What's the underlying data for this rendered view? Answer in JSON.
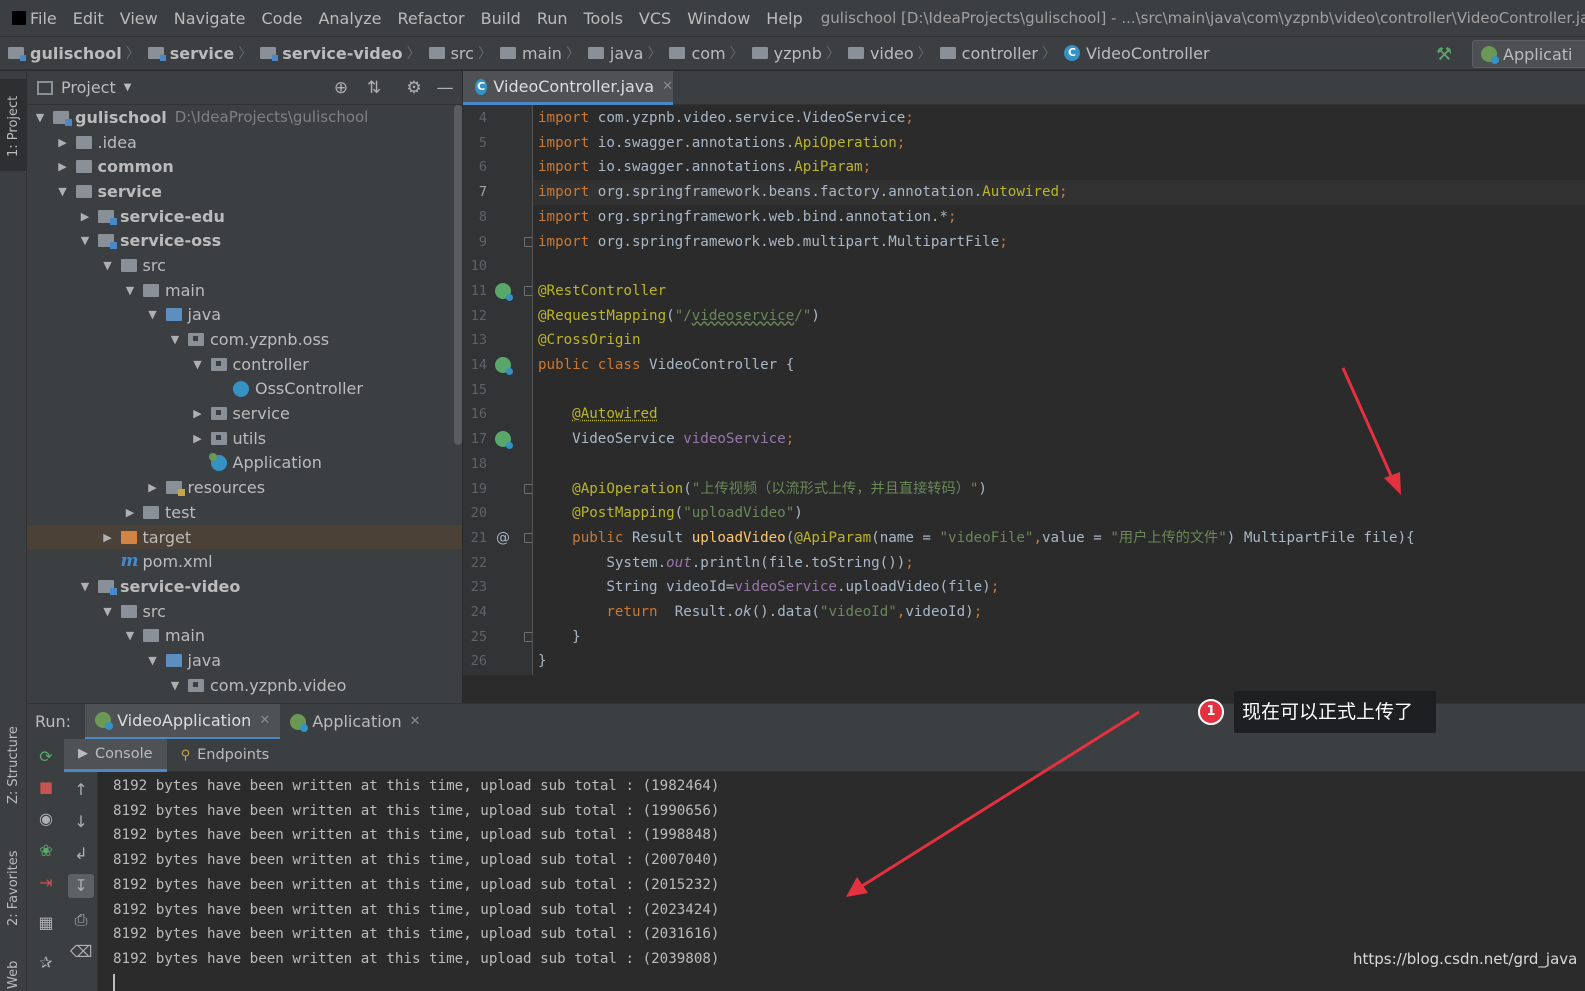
{
  "menu": {
    "items": [
      "File",
      "Edit",
      "View",
      "Navigate",
      "Code",
      "Analyze",
      "Refactor",
      "Build",
      "Run",
      "Tools",
      "VCS",
      "Window",
      "Help"
    ],
    "window_title": "gulischool [D:\\IdeaProjects\\gulischool] - ...\\src\\main\\java\\com\\yzpnb\\video\\controller\\VideoController.java [se"
  },
  "breadcrumbs": [
    "gulischool",
    "service",
    "service-video",
    "src",
    "main",
    "java",
    "com",
    "yzpnb",
    "video",
    "controller",
    "VideoController"
  ],
  "run_config": {
    "label": "Applicati"
  },
  "left_strip": {
    "project": "1: Project",
    "structure": "Z: Structure",
    "favorites": "2: Favorites",
    "web": "Web"
  },
  "project_panel": {
    "title": "Project",
    "tree": [
      {
        "label": "gulischool",
        "path": "D:\\IdeaProjects\\gulischool",
        "bold": true,
        "arrow": "open",
        "icon": "module",
        "depth": 0
      },
      {
        "label": ".idea",
        "arrow": "closed",
        "icon": "folder",
        "depth": 1
      },
      {
        "label": "common",
        "bold": true,
        "arrow": "closed",
        "icon": "folder",
        "depth": 1
      },
      {
        "label": "service",
        "bold": true,
        "arrow": "open",
        "icon": "folder",
        "depth": 1
      },
      {
        "label": "service-edu",
        "bold": true,
        "arrow": "closed",
        "icon": "module",
        "depth": 2
      },
      {
        "label": "service-oss",
        "bold": true,
        "arrow": "open",
        "icon": "module",
        "depth": 2
      },
      {
        "label": "src",
        "arrow": "open",
        "icon": "folder",
        "depth": 3
      },
      {
        "label": "main",
        "arrow": "open",
        "icon": "folder",
        "depth": 4
      },
      {
        "label": "java",
        "arrow": "open",
        "icon": "source",
        "depth": 5
      },
      {
        "label": "com.yzpnb.oss",
        "arrow": "open",
        "icon": "package",
        "depth": 6
      },
      {
        "label": "controller",
        "arrow": "open",
        "icon": "package",
        "depth": 7
      },
      {
        "label": "OssController",
        "arrow": "none",
        "icon": "cls",
        "depth": 8
      },
      {
        "label": "service",
        "arrow": "closed",
        "icon": "package",
        "depth": 7
      },
      {
        "label": "utils",
        "arrow": "closed",
        "icon": "package",
        "depth": 7
      },
      {
        "label": "Application",
        "arrow": "none",
        "icon": "appcls",
        "depth": 7
      },
      {
        "label": "resources",
        "arrow": "closed",
        "icon": "resources",
        "depth": 5
      },
      {
        "label": "test",
        "arrow": "closed",
        "icon": "folder",
        "depth": 4
      },
      {
        "label": "target",
        "arrow": "closed",
        "icon": "excluded",
        "depth": 3,
        "selected": true
      },
      {
        "label": "pom.xml",
        "arrow": "none",
        "icon": "maven",
        "depth": 3
      },
      {
        "label": "service-video",
        "bold": true,
        "arrow": "open",
        "icon": "module",
        "depth": 2
      },
      {
        "label": "src",
        "arrow": "open",
        "icon": "folder",
        "depth": 3
      },
      {
        "label": "main",
        "arrow": "open",
        "icon": "folder",
        "depth": 4
      },
      {
        "label": "java",
        "arrow": "open",
        "icon": "source",
        "depth": 5
      },
      {
        "label": "com.yzpnb.video",
        "arrow": "open",
        "icon": "package",
        "depth": 6
      }
    ]
  },
  "editor": {
    "tab_label": "VideoController.java",
    "current_line": 7,
    "lines": [
      {
        "n": 4,
        "parts": [
          [
            "kw",
            "import "
          ],
          [
            "",
            "com.yzpnb.video.service.VideoService"
          ],
          [
            "kw",
            ";"
          ]
        ]
      },
      {
        "n": 5,
        "parts": [
          [
            "kw",
            "import "
          ],
          [
            "",
            "io.swagger.annotations."
          ],
          [
            "ann",
            "ApiOperation"
          ],
          [
            "kw",
            ";"
          ]
        ]
      },
      {
        "n": 6,
        "parts": [
          [
            "kw",
            "import "
          ],
          [
            "",
            "io.swagger.annotations."
          ],
          [
            "ann",
            "ApiParam"
          ],
          [
            "kw",
            ";"
          ]
        ]
      },
      {
        "n": 7,
        "parts": [
          [
            "kw",
            "import "
          ],
          [
            "",
            "org.springframework.beans.factory.annotation."
          ],
          [
            "ann",
            "Autowired"
          ],
          [
            "kw",
            ";"
          ]
        ]
      },
      {
        "n": 8,
        "parts": [
          [
            "kw",
            "import "
          ],
          [
            "",
            "org.springframework.web.bind.annotation.*"
          ],
          [
            "kw",
            ";"
          ]
        ]
      },
      {
        "n": 9,
        "parts": [
          [
            "kw",
            "import "
          ],
          [
            "",
            "org.springframework.web.multipart.MultipartFile"
          ],
          [
            "kw",
            ";"
          ]
        ]
      },
      {
        "n": 10,
        "parts": []
      },
      {
        "n": 11,
        "parts": [
          [
            "ann",
            "@RestController"
          ]
        ]
      },
      {
        "n": 12,
        "parts": [
          [
            "ann",
            "@RequestMapping"
          ],
          [
            "",
            "("
          ],
          [
            "str",
            "\"/"
          ],
          [
            "str ulw",
            "videoservice"
          ],
          [
            "str",
            "/\""
          ],
          [
            "",
            ")"
          ]
        ]
      },
      {
        "n": 13,
        "parts": [
          [
            "ann",
            "@CrossOrigin"
          ]
        ]
      },
      {
        "n": 14,
        "parts": [
          [
            "kw",
            "public class "
          ],
          [
            "",
            "VideoController {"
          ]
        ]
      },
      {
        "n": 15,
        "parts": []
      },
      {
        "n": 16,
        "parts": [
          [
            "",
            "    "
          ],
          [
            "ann uld",
            "@Autowired"
          ]
        ]
      },
      {
        "n": 17,
        "parts": [
          [
            "",
            "    VideoService "
          ],
          [
            "fld",
            "videoService"
          ],
          [
            "kw",
            ";"
          ]
        ]
      },
      {
        "n": 18,
        "parts": []
      },
      {
        "n": 19,
        "parts": [
          [
            "",
            "    "
          ],
          [
            "ann",
            "@ApiOperation"
          ],
          [
            "",
            "("
          ],
          [
            "str",
            "\"上传视频（以流形式上传，并且直接转码）\""
          ],
          [
            "",
            ")"
          ]
        ]
      },
      {
        "n": 20,
        "parts": [
          [
            "",
            "    "
          ],
          [
            "ann",
            "@PostMapping"
          ],
          [
            "",
            "("
          ],
          [
            "str",
            "\"uploadVideo\""
          ],
          [
            "",
            ")"
          ]
        ]
      },
      {
        "n": 21,
        "parts": [
          [
            "",
            "    "
          ],
          [
            "kw",
            "public "
          ],
          [
            "",
            "Result "
          ],
          [
            "fn",
            "uploadVideo"
          ],
          [
            "",
            "("
          ],
          [
            "ann",
            "@ApiParam"
          ],
          [
            "",
            "(name = "
          ],
          [
            "str",
            "\"videoFile\""
          ],
          [
            "kw",
            ","
          ],
          [
            "",
            "value = "
          ],
          [
            "str",
            "\"用户上传的文件\""
          ],
          [
            "",
            ") MultipartFile file){"
          ]
        ]
      },
      {
        "n": 22,
        "parts": [
          [
            "",
            "        System."
          ],
          [
            "fld ital",
            "out"
          ],
          [
            "",
            ".println(file.toString())"
          ],
          [
            "kw",
            ";"
          ]
        ]
      },
      {
        "n": 23,
        "parts": [
          [
            "",
            "        String videoId="
          ],
          [
            "fld",
            "videoService"
          ],
          [
            "",
            ".uploadVideo(file)"
          ],
          [
            "kw",
            ";"
          ]
        ]
      },
      {
        "n": 24,
        "parts": [
          [
            "",
            "        "
          ],
          [
            "kw",
            "return  "
          ],
          [
            "",
            "Result."
          ],
          [
            "ital",
            "ok"
          ],
          [
            "",
            "().data("
          ],
          [
            "str",
            "\"videoId\""
          ],
          [
            "kw",
            ","
          ],
          [
            "",
            "videoId)"
          ],
          [
            "kw",
            ";"
          ]
        ]
      },
      {
        "n": 25,
        "parts": [
          [
            "",
            "    }"
          ]
        ]
      },
      {
        "n": 26,
        "parts": [
          [
            "",
            "}"
          ]
        ]
      }
    ]
  },
  "run_panel": {
    "label": "Run:",
    "tabs": [
      {
        "label": "VideoApplication",
        "active": true
      },
      {
        "label": "Application",
        "active": false
      }
    ],
    "subtabs": {
      "console": "Console",
      "endpoints": "Endpoints"
    },
    "console_lines": [
      "8192 bytes have been written at this time, upload sub total : (1982464)",
      "8192 bytes have been written at this time, upload sub total : (1990656)",
      "8192 bytes have been written at this time, upload sub total : (1998848)",
      "8192 bytes have been written at this time, upload sub total : (2007040)",
      "8192 bytes have been written at this time, upload sub total : (2015232)",
      "8192 bytes have been written at this time, upload sub total : (2023424)",
      "8192 bytes have been written at this time, upload sub total : (2031616)",
      "8192 bytes have been written at this time, upload sub total : (2039808)"
    ]
  },
  "annotation": {
    "badge": "1",
    "tooltip": "现在可以正式上传了"
  },
  "watermark": "https://blog.csdn.net/grd_java",
  "colors": {
    "accent": "#4a88c7",
    "arrow": "#e5303f",
    "keyword": "#cc7832",
    "annotation": "#bbb529",
    "string": "#6a8759"
  }
}
